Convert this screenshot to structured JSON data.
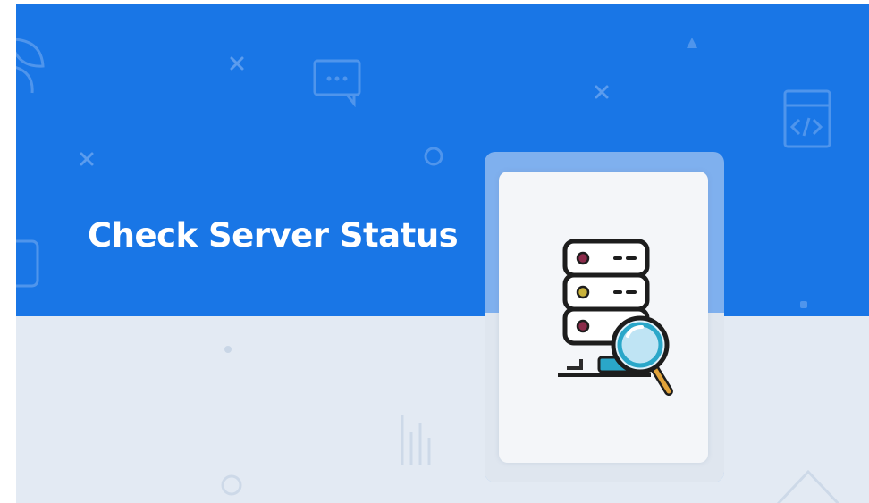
{
  "banner": {
    "title": "Check Server Status",
    "colors": {
      "primary_blue": "#1976e6",
      "light_background": "#e3eaf3",
      "card_frame": "#7fb0ee",
      "card_surface": "#f4f6f9",
      "title_text": "#ffffff"
    },
    "illustration": {
      "icon": "server-search-icon",
      "led_colors": [
        "#8b2b4a",
        "#c9b23a",
        "#8b2b4a"
      ]
    },
    "background_icons": [
      "leaf-icon",
      "close-icon",
      "chat-bubble-icon",
      "code-window-icon",
      "circle-icon",
      "triangle-icon",
      "bar-chart-icon"
    ]
  }
}
